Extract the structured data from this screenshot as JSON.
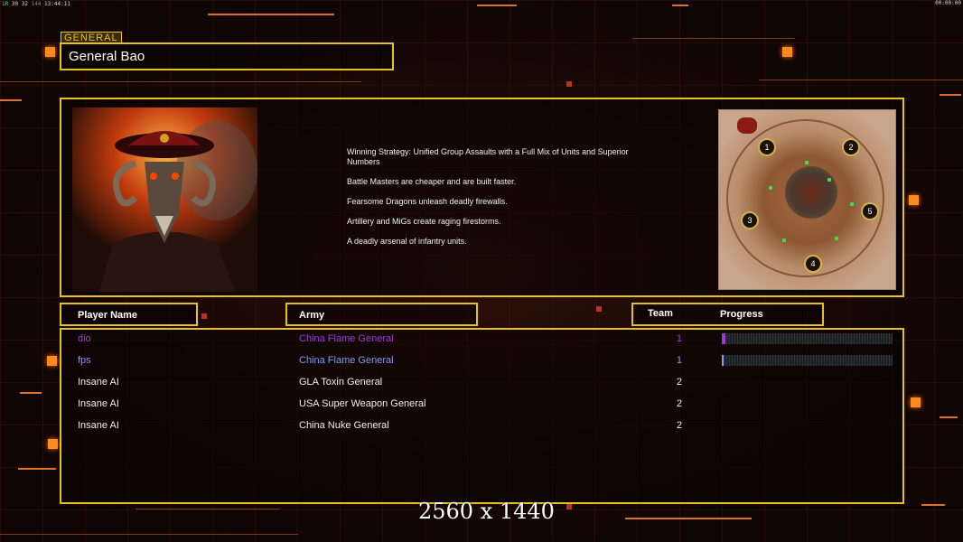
{
  "status": {
    "fps_a": "1R",
    "fps_b": "30",
    "fps_c": "32",
    "fps_d": "144",
    "time": "13:44:11",
    "clock": "00:00:00"
  },
  "general": {
    "tag": "GENERAL",
    "name": "General Bao"
  },
  "description": [
    "Winning Strategy: Unified Group Assaults with a Full Mix of Units and Superior Numbers",
    "Battle Masters are cheaper and are built faster.",
    "Fearsome Dragons unleash deadly firewalls.",
    "Artillery and MiGs create raging firestorms.",
    "A deadly arsenal of infantry units."
  ],
  "minimap": {
    "positions": [
      "1",
      "2",
      "3",
      "4",
      "5"
    ]
  },
  "headers": {
    "player": "Player Name",
    "army": "Army",
    "team": "Team",
    "progress": "Progress"
  },
  "players": [
    {
      "name": "dio",
      "army": "China Flame General",
      "team": "1",
      "progress": 0.02,
      "color": "#9c3cd8",
      "style": "purple"
    },
    {
      "name": "fps",
      "army": "China Flame General",
      "team": "1",
      "progress": 0.01,
      "color": "#8a9af0",
      "style": "blue"
    },
    {
      "name": "Insane AI",
      "army": "GLA Toxin General",
      "team": "2",
      "style": "white"
    },
    {
      "name": "Insane AI",
      "army": "USA Super Weapon General",
      "team": "2",
      "style": "white"
    },
    {
      "name": "Insane AI",
      "army": "China Nuke General",
      "team": "2",
      "style": "white"
    }
  ],
  "resolution": "2560 x 1440",
  "colors": {
    "accent": "#e8c21c",
    "orange": "#ff8a1f"
  }
}
